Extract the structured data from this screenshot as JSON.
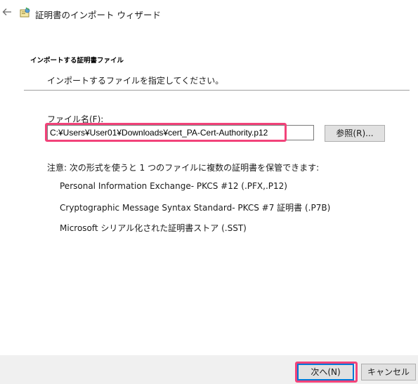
{
  "window": {
    "title": "証明書のインポート ウィザード",
    "back_icon": "back-arrow-icon",
    "wizard_icon": "certificate-wizard-icon"
  },
  "header": {
    "heading": "インポートする証明書ファイル",
    "subheading": "インポートするファイルを指定してください。"
  },
  "file": {
    "label": "ファイル名(F):",
    "value": "C:¥Users¥User01¥Downloads¥cert_PA-Cert-Authority.p12",
    "browse_label": "参照(R)..."
  },
  "note": {
    "intro": "注意: 次の形式を使うと 1 つのファイルに複数の証明書を保管できます:",
    "formats": [
      "Personal Information Exchange- PKCS #12 (.PFX,.P12)",
      "Cryptographic Message Syntax Standard- PKCS #7 証明書 (.P7B)",
      "Microsoft シリアル化された証明書ストア (.SST)"
    ]
  },
  "footer": {
    "next_label": "次へ(N)",
    "cancel_label": "キャンセル"
  },
  "colors": {
    "highlight": "#f2437a",
    "focus": "#0078d7"
  }
}
